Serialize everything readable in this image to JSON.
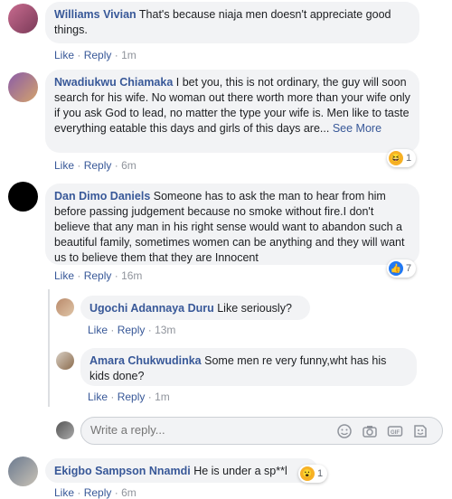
{
  "comments": [
    {
      "author": "Williams Vivian",
      "text": "That's because niaja men doesn't appreciate good things.",
      "time": "1m",
      "reactions": null
    },
    {
      "author": "Nwadiukwu Chiamaka",
      "text": "I bet you, this is not ordinary, the guy will soon search for his wife. No woman out there worth more than your wife only if you ask God to lead, no matter the type your wife is. Men like to taste everything eatable this days and girls of this days are...",
      "see_more": "See More",
      "time": "6m",
      "reactions": "1"
    },
    {
      "author": "Dan Dimo Daniels",
      "text": "Someone has to ask the man to hear from him before passing judgement because no smoke without fire.I don't believe that any man in his right sense would want to abandon such a beautiful family, sometimes women can be anything and they will want us to believe them that they are Innocent",
      "time": "16m",
      "reactions": "7"
    },
    {
      "author": "Ugochi Adannaya Duru",
      "text": "Like seriously?",
      "time": "13m",
      "reactions": null
    },
    {
      "author": "Amara Chukwudinka",
      "text": "Some men re very funny,wht has his kids done?",
      "time": "1m",
      "reactions": null
    },
    {
      "author": "Ekigbo Sampson Nnamdi",
      "text": "He is under a sp**l",
      "time": "6m",
      "reactions": "1"
    }
  ],
  "actions": {
    "like": "Like",
    "reply": "Reply",
    "sep": "·"
  },
  "reply_box": {
    "placeholder": "Write a reply..."
  },
  "colors": {
    "link": "#385898",
    "bubble": "#f2f3f5",
    "like_blue": "#2078f4",
    "haha_yellow": "#f7b125"
  }
}
